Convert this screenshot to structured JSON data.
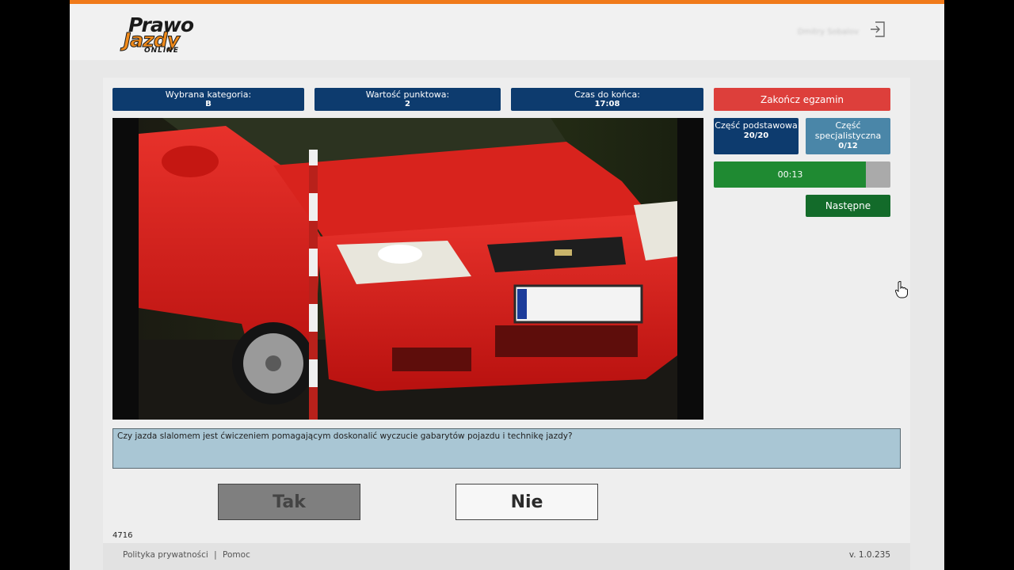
{
  "header": {
    "logo_line1": "Prawo",
    "logo_line2": "Jazdy",
    "logo_line3": "ONLINE",
    "user_name": "Dmitry Sobalov"
  },
  "info": {
    "category_label": "Wybrana kategoria:",
    "category_value": "B",
    "points_label": "Wartość punktowa:",
    "points_value": "2",
    "time_label": "Czas do końca:",
    "time_value": "17:08"
  },
  "sidebar": {
    "end_exam": "Zakończ egzamin",
    "basic_part_label": "Część podstawowa",
    "basic_part_value": "20/20",
    "special_part_label": "Część specjalistyczna",
    "special_part_value": "0/12",
    "timer_text": "00:13",
    "timer_progress": 0.86,
    "next_button": "Następne"
  },
  "question": {
    "text": "Czy jazda slalomem jest ćwiczeniem pomagającym doskonalić wyczucie gabarytów pojazdu i technikę jazdy?",
    "answer_yes": "Tak",
    "answer_no": "Nie",
    "id": "4716"
  },
  "footer": {
    "privacy": "Polityka prywatności",
    "separator": "|",
    "help": "Pomoc",
    "version": "v. 1.0.235"
  },
  "colors": {
    "accent": "#f07a1a",
    "navy": "#0d3b6e",
    "end_red": "#dd3f3b",
    "special_blue": "#4a86a8",
    "timer_green": "#1f8a32",
    "next_green": "#136b2a",
    "question_bg": "#a9c6d4"
  }
}
